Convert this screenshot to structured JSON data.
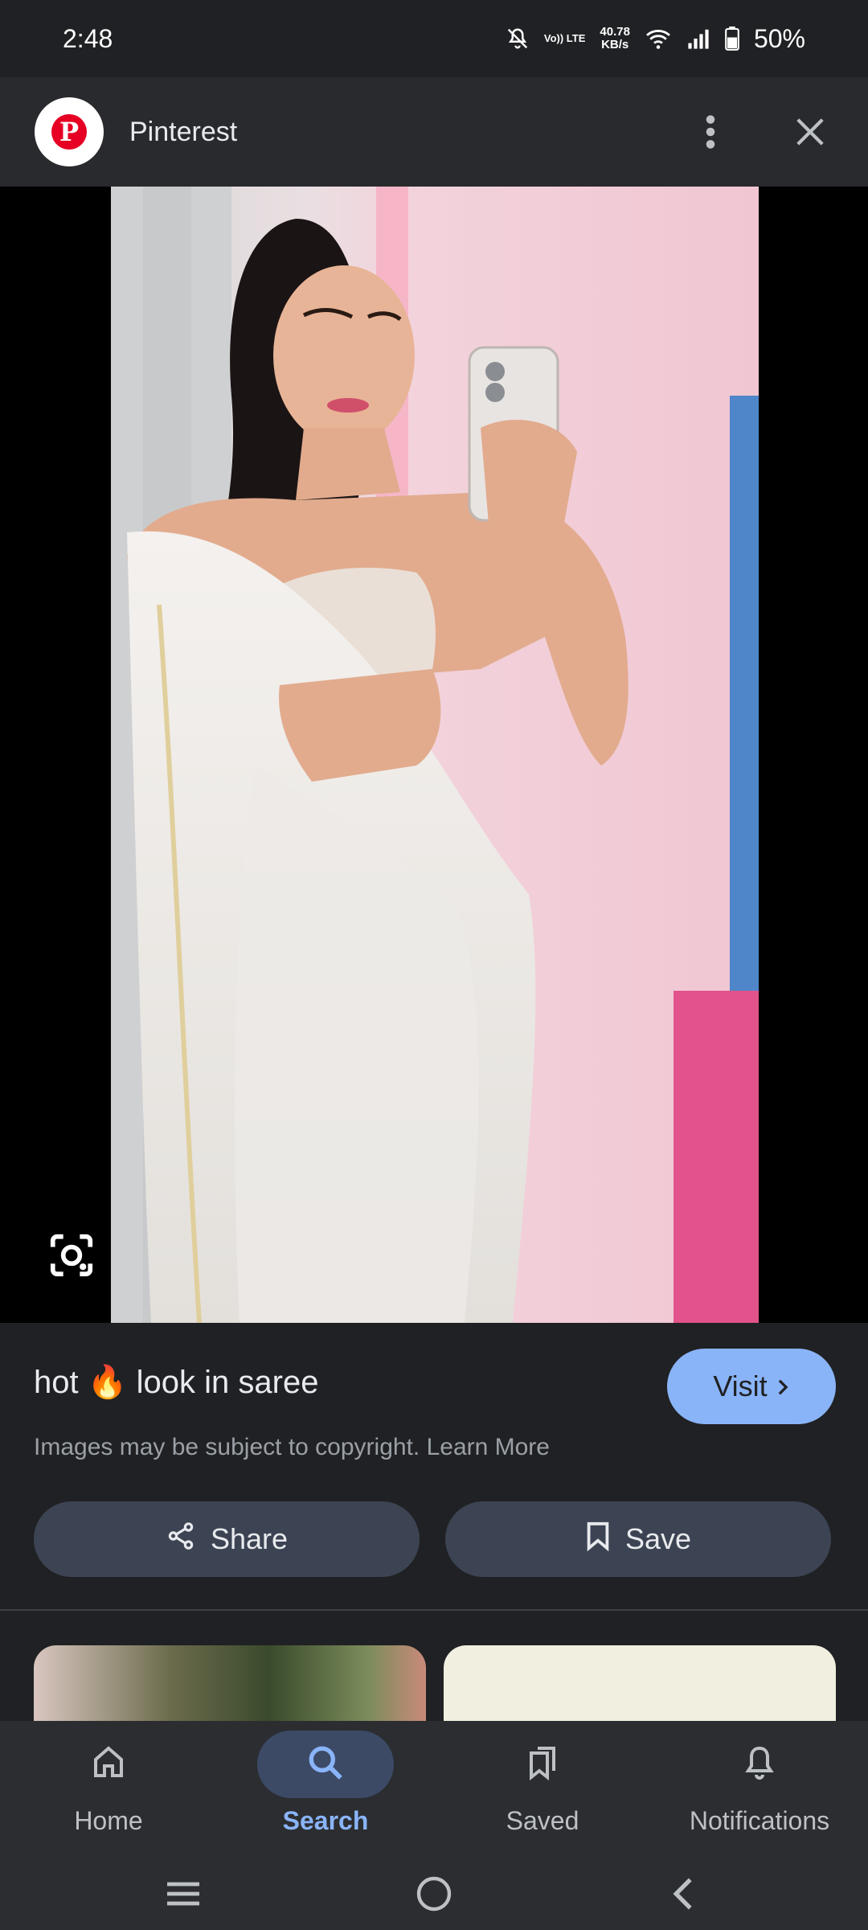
{
  "status_bar": {
    "time": "2:48",
    "volte": "Vo)) LTE",
    "net_speed_value": "40.78",
    "net_speed_unit": "KB/s",
    "battery": "50%"
  },
  "header": {
    "app_name": "Pinterest",
    "logo_letter": "P"
  },
  "image": {
    "title": "hot 🔥 look in saree",
    "copyright": "Images may be subject to copyright. Learn More"
  },
  "actions": {
    "visit_label": "Visit",
    "share_label": "Share",
    "save_label": "Save"
  },
  "bottom_nav": {
    "items": [
      {
        "label": "Home",
        "icon": "home-icon",
        "active": false
      },
      {
        "label": "Search",
        "icon": "search-icon",
        "active": true
      },
      {
        "label": "Saved",
        "icon": "saved-icon",
        "active": false
      },
      {
        "label": "Notifications",
        "icon": "bell-icon",
        "active": false
      }
    ]
  },
  "colors": {
    "accent": "#8ab4f8",
    "brand": "#e60023",
    "background": "#202124"
  }
}
